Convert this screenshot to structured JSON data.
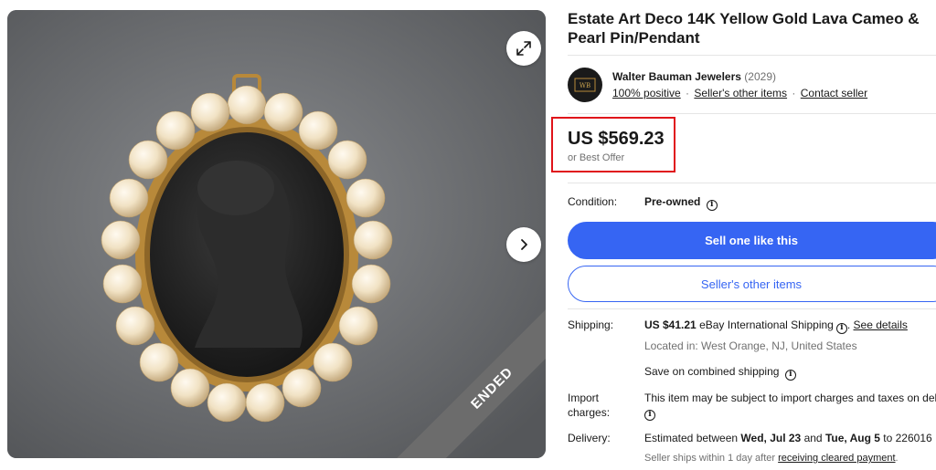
{
  "listing": {
    "title": "Estate Art Deco 14K Yellow Gold Lava Cameo & Pearl Pin/Pendant",
    "ended_label": "ENDED"
  },
  "icons": {
    "expand": "expand-icon",
    "next": "chevron-right-icon",
    "info": "info-icon"
  },
  "seller": {
    "name": "Walter Bauman Jewelers",
    "feedback_count": "(2029)",
    "positive": "100% positive",
    "other_items_link": "Seller's other items",
    "contact": "Contact seller"
  },
  "price": {
    "amount": "US $569.23",
    "best_offer": "or Best Offer"
  },
  "condition": {
    "label": "Condition:",
    "value": "Pre-owned"
  },
  "buttons": {
    "sell_one": "Sell one like this",
    "other_items": "Seller's other items"
  },
  "shipping": {
    "label": "Shipping:",
    "cost": "US $41.21",
    "method": "eBay International Shipping",
    "see_details": "See details",
    "location": "Located in: West Orange, NJ, United States",
    "combined": "Save on combined shipping"
  },
  "import": {
    "label_line1": "Import",
    "label_line2": "charges:",
    "text": "This item may be subject to import charges and taxes on deli"
  },
  "delivery": {
    "label": "Delivery:",
    "prefix": "Estimated between",
    "date_start": "Wed, Jul 23",
    "and": "and",
    "date_end": "Tue, Aug 5",
    "to_zip": "to 226016",
    "ship_note_prefix": "Seller ships within 1 day after",
    "ship_note_link": "receiving cleared payment",
    "ship_note_suffix": "."
  },
  "colors": {
    "primary": "#3665f3",
    "highlight_border": "#e0131a",
    "ribbon": "#6c6c6c",
    "gold": "#b8893a",
    "lava": "#1c1c1c",
    "pearl": "#f3e6cd"
  }
}
